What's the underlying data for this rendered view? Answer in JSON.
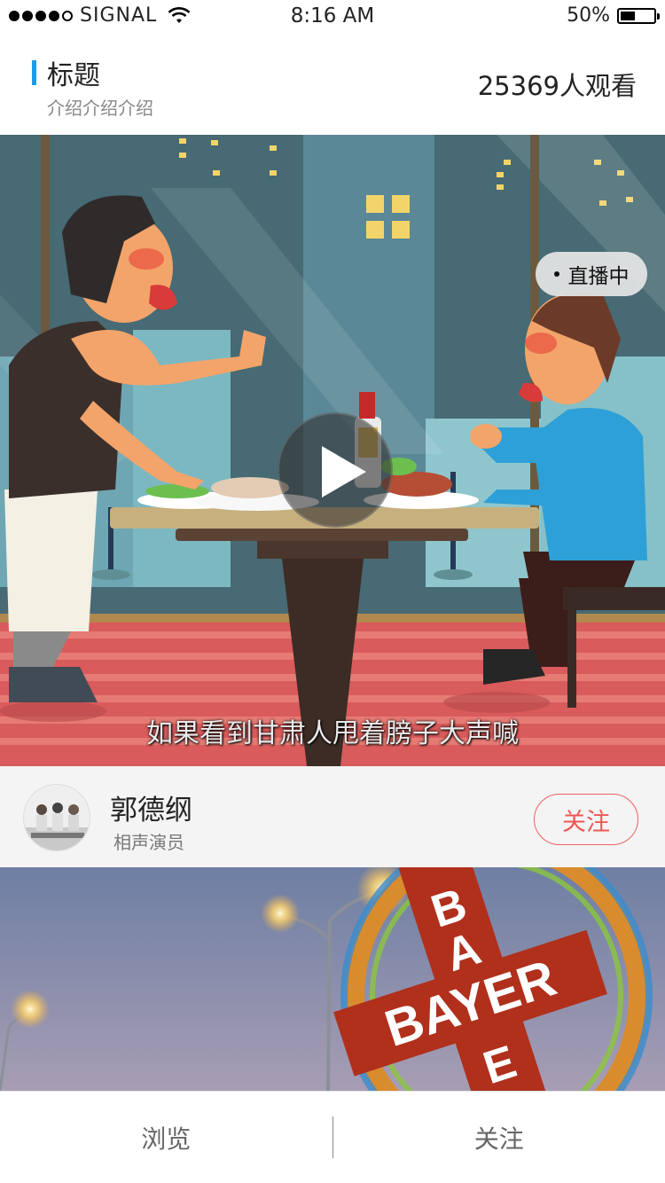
{
  "status_bar": {
    "carrier": "SIGNAL",
    "time": "8:16 AM",
    "battery_percent_label": "50%",
    "battery_level": 0.5,
    "signal_bars": 4,
    "signal_max": 5
  },
  "header": {
    "title": "标题",
    "subtitle": "介绍介绍介绍",
    "viewers": "25369人观看",
    "accent_color": "#1d9be8"
  },
  "video": {
    "live_label": "直播中",
    "caption": "如果看到甘肃人甩着膀子大声喊"
  },
  "profile": {
    "name": "郭德纲",
    "role": "相声演员",
    "follow_label": "关注",
    "follow_color": "#ef5757"
  },
  "banner": {
    "logo_text": "BAYER"
  },
  "tabs": [
    {
      "label": "浏览"
    },
    {
      "label": "关注"
    }
  ]
}
